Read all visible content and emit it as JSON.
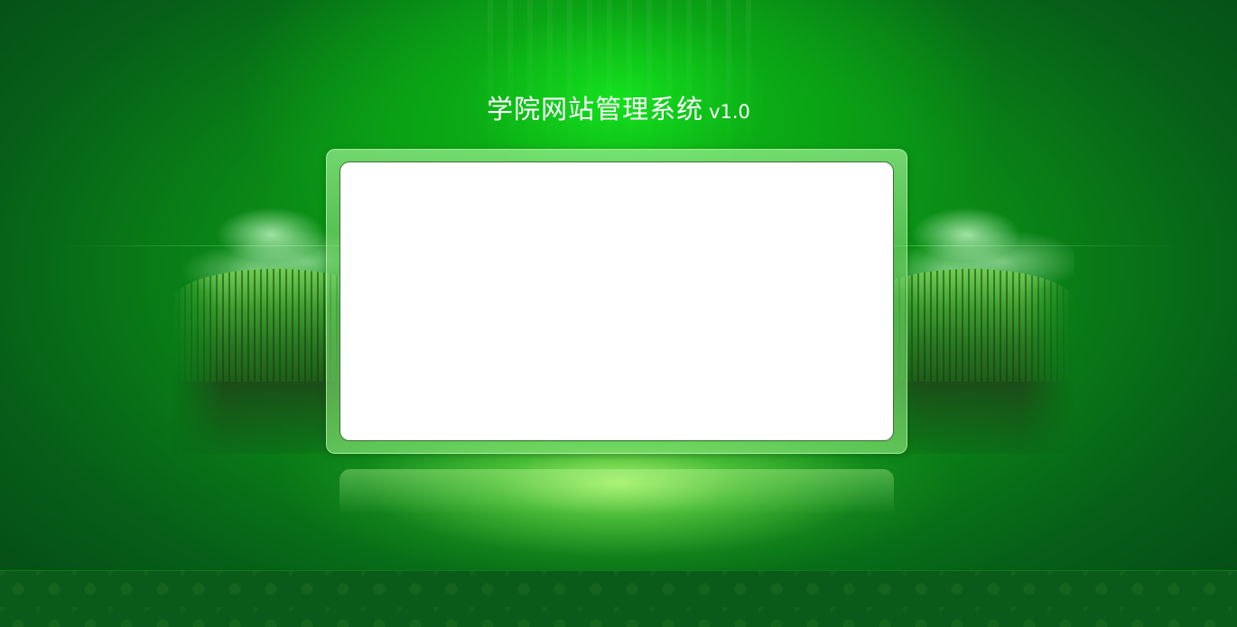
{
  "header": {
    "title": "学院网站管理系统",
    "version": "v1.0"
  },
  "login_panel": {
    "content": ""
  },
  "colors": {
    "background": "#0a8a16",
    "glow": "#14e61e",
    "footer": "#0a5a1a",
    "panel": "#ffffff"
  }
}
